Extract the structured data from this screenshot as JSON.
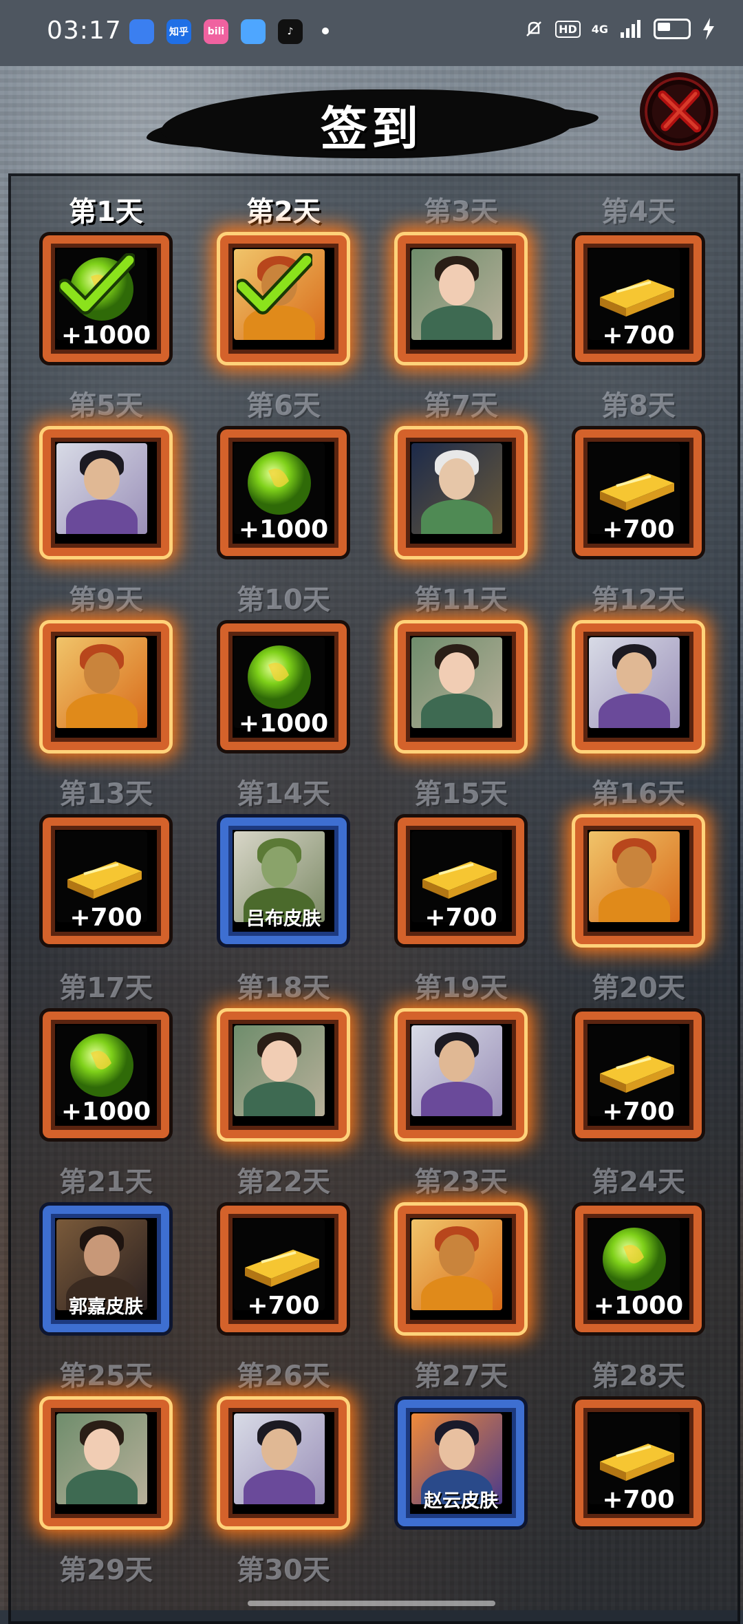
{
  "status_bar": {
    "time": "03:17",
    "app_icons": [
      {
        "name": "app-icon-blue",
        "color": "#3b7ff0",
        "label": ""
      },
      {
        "name": "zhihu-icon",
        "color": "#1f6fe6",
        "label": "知乎"
      },
      {
        "name": "bilibili-icon",
        "color": "#f062a0",
        "label": "bili"
      },
      {
        "name": "app-icon-cloud",
        "color": "#4ea6ff",
        "label": ""
      },
      {
        "name": "tiktok-icon",
        "color": "#111111",
        "label": "♪"
      }
    ],
    "hd": "HD",
    "network": "4G"
  },
  "title": "签到",
  "days": [
    {
      "label": "第1天",
      "reward": "jade",
      "amount": "+1000",
      "claimed": true
    },
    {
      "label": "第2天",
      "reward": "warrior",
      "amount": "",
      "claimed": true
    },
    {
      "label": "第3天",
      "reward": "lady",
      "amount": "",
      "claimed": false
    },
    {
      "label": "第4天",
      "reward": "gold",
      "amount": "+700",
      "claimed": false
    },
    {
      "label": "第5天",
      "reward": "swordsman",
      "amount": "",
      "claimed": false
    },
    {
      "label": "第6天",
      "reward": "jade",
      "amount": "+1000",
      "claimed": false
    },
    {
      "label": "第7天",
      "reward": "sage",
      "amount": "",
      "claimed": false
    },
    {
      "label": "第8天",
      "reward": "gold",
      "amount": "+700",
      "claimed": false
    },
    {
      "label": "第9天",
      "reward": "warrior",
      "amount": "",
      "claimed": false
    },
    {
      "label": "第10天",
      "reward": "jade",
      "amount": "+1000",
      "claimed": false
    },
    {
      "label": "第11天",
      "reward": "lady",
      "amount": "",
      "claimed": false
    },
    {
      "label": "第12天",
      "reward": "swordsman",
      "amount": "",
      "claimed": false
    },
    {
      "label": "第13天",
      "reward": "gold",
      "amount": "+700",
      "claimed": false
    },
    {
      "label": "第14天",
      "reward": "skin-lvbu",
      "amount": "吕布皮肤",
      "claimed": false
    },
    {
      "label": "第15天",
      "reward": "gold",
      "amount": "+700",
      "claimed": false
    },
    {
      "label": "第16天",
      "reward": "warrior",
      "amount": "",
      "claimed": false
    },
    {
      "label": "第17天",
      "reward": "jade",
      "amount": "+1000",
      "claimed": false
    },
    {
      "label": "第18天",
      "reward": "lady",
      "amount": "",
      "claimed": false
    },
    {
      "label": "第19天",
      "reward": "swordsman",
      "amount": "",
      "claimed": false
    },
    {
      "label": "第20天",
      "reward": "gold",
      "amount": "+700",
      "claimed": false
    },
    {
      "label": "第21天",
      "reward": "skin-guojia",
      "amount": "郭嘉皮肤",
      "claimed": false
    },
    {
      "label": "第22天",
      "reward": "gold",
      "amount": "+700",
      "claimed": false
    },
    {
      "label": "第23天",
      "reward": "warrior",
      "amount": "",
      "claimed": false
    },
    {
      "label": "第24天",
      "reward": "jade",
      "amount": "+1000",
      "claimed": false
    },
    {
      "label": "第25天",
      "reward": "lady",
      "amount": "",
      "claimed": false
    },
    {
      "label": "第26天",
      "reward": "swordsman",
      "amount": "",
      "claimed": false
    },
    {
      "label": "第27天",
      "reward": "skin-zhaoyun",
      "amount": "赵云皮肤",
      "claimed": false
    },
    {
      "label": "第28天",
      "reward": "gold",
      "amount": "+700",
      "claimed": false
    },
    {
      "label": "第29天",
      "reward": "",
      "amount": "",
      "claimed": false
    },
    {
      "label": "第30天",
      "reward": "",
      "amount": "",
      "claimed": false
    }
  ]
}
